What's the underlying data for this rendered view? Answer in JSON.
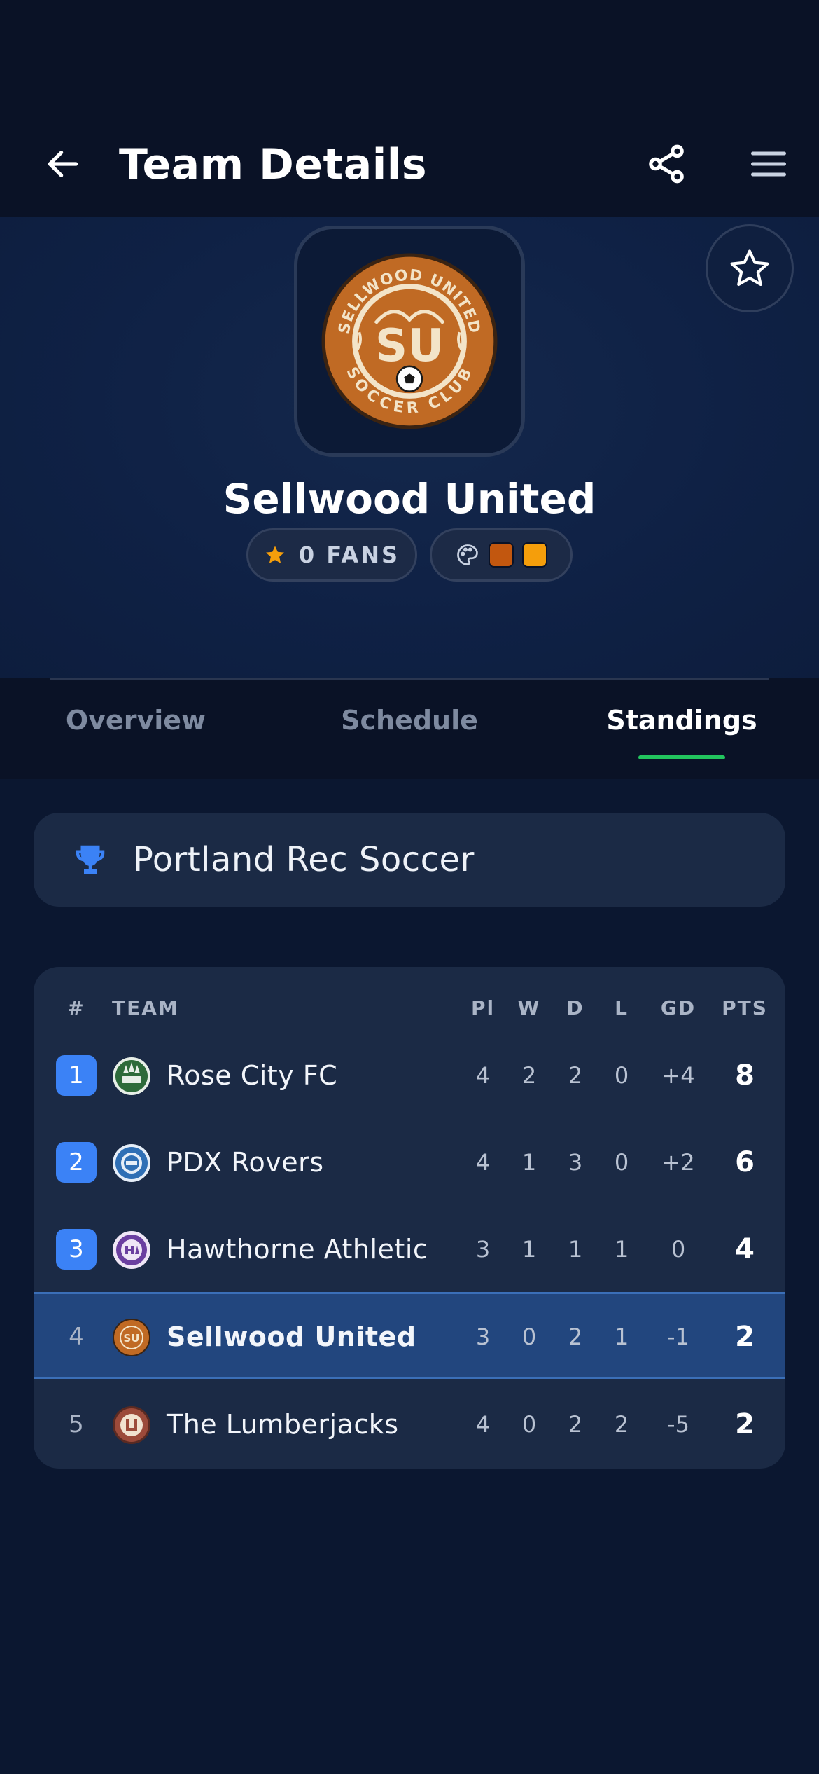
{
  "header": {
    "title": "Team Details"
  },
  "team": {
    "name": "Sellwood United",
    "fans_label": "0 FANS",
    "logo_text_top": "SELLWOOD UNITED",
    "logo_text_bottom": "SOCCER CLUB",
    "logo_monogram": "SU",
    "colors": [
      "#c2570f",
      "#f59e0b"
    ]
  },
  "tabs": [
    {
      "label": "Overview",
      "active": false
    },
    {
      "label": "Schedule",
      "active": false
    },
    {
      "label": "Standings",
      "active": true
    }
  ],
  "league": {
    "name": "Portland Rec Soccer"
  },
  "standings": {
    "columns": [
      "#",
      "TEAM",
      "Pl",
      "W",
      "D",
      "L",
      "GD",
      "PTS"
    ],
    "rows": [
      {
        "rank": "1",
        "team": "Rose City FC",
        "pl": "4",
        "w": "2",
        "d": "2",
        "l": "0",
        "gd": "+4",
        "pts": "8"
      },
      {
        "rank": "2",
        "team": "PDX Rovers",
        "pl": "4",
        "w": "1",
        "d": "3",
        "l": "0",
        "gd": "+2",
        "pts": "6"
      },
      {
        "rank": "3",
        "team": "Hawthorne Athletic",
        "pl": "3",
        "w": "1",
        "d": "1",
        "l": "1",
        "gd": "0",
        "pts": "4"
      },
      {
        "rank": "4",
        "team": "Sellwood United",
        "pl": "3",
        "w": "0",
        "d": "2",
        "l": "1",
        "gd": "-1",
        "pts": "2"
      },
      {
        "rank": "5",
        "team": "The Lumberjacks",
        "pl": "4",
        "w": "0",
        "d": "2",
        "l": "2",
        "gd": "-5",
        "pts": "2"
      }
    ]
  },
  "colors": {
    "accent_blue": "#3b82f6",
    "tab_indicator": "#22c55e",
    "star": "#f59e0b"
  },
  "icons": {
    "back": "arrow-left-icon",
    "share": "share-icon",
    "menu": "menu-icon",
    "favorite": "star-outline-icon",
    "fans": "star-filled-icon",
    "palette": "palette-icon",
    "league": "trophy-icon"
  }
}
